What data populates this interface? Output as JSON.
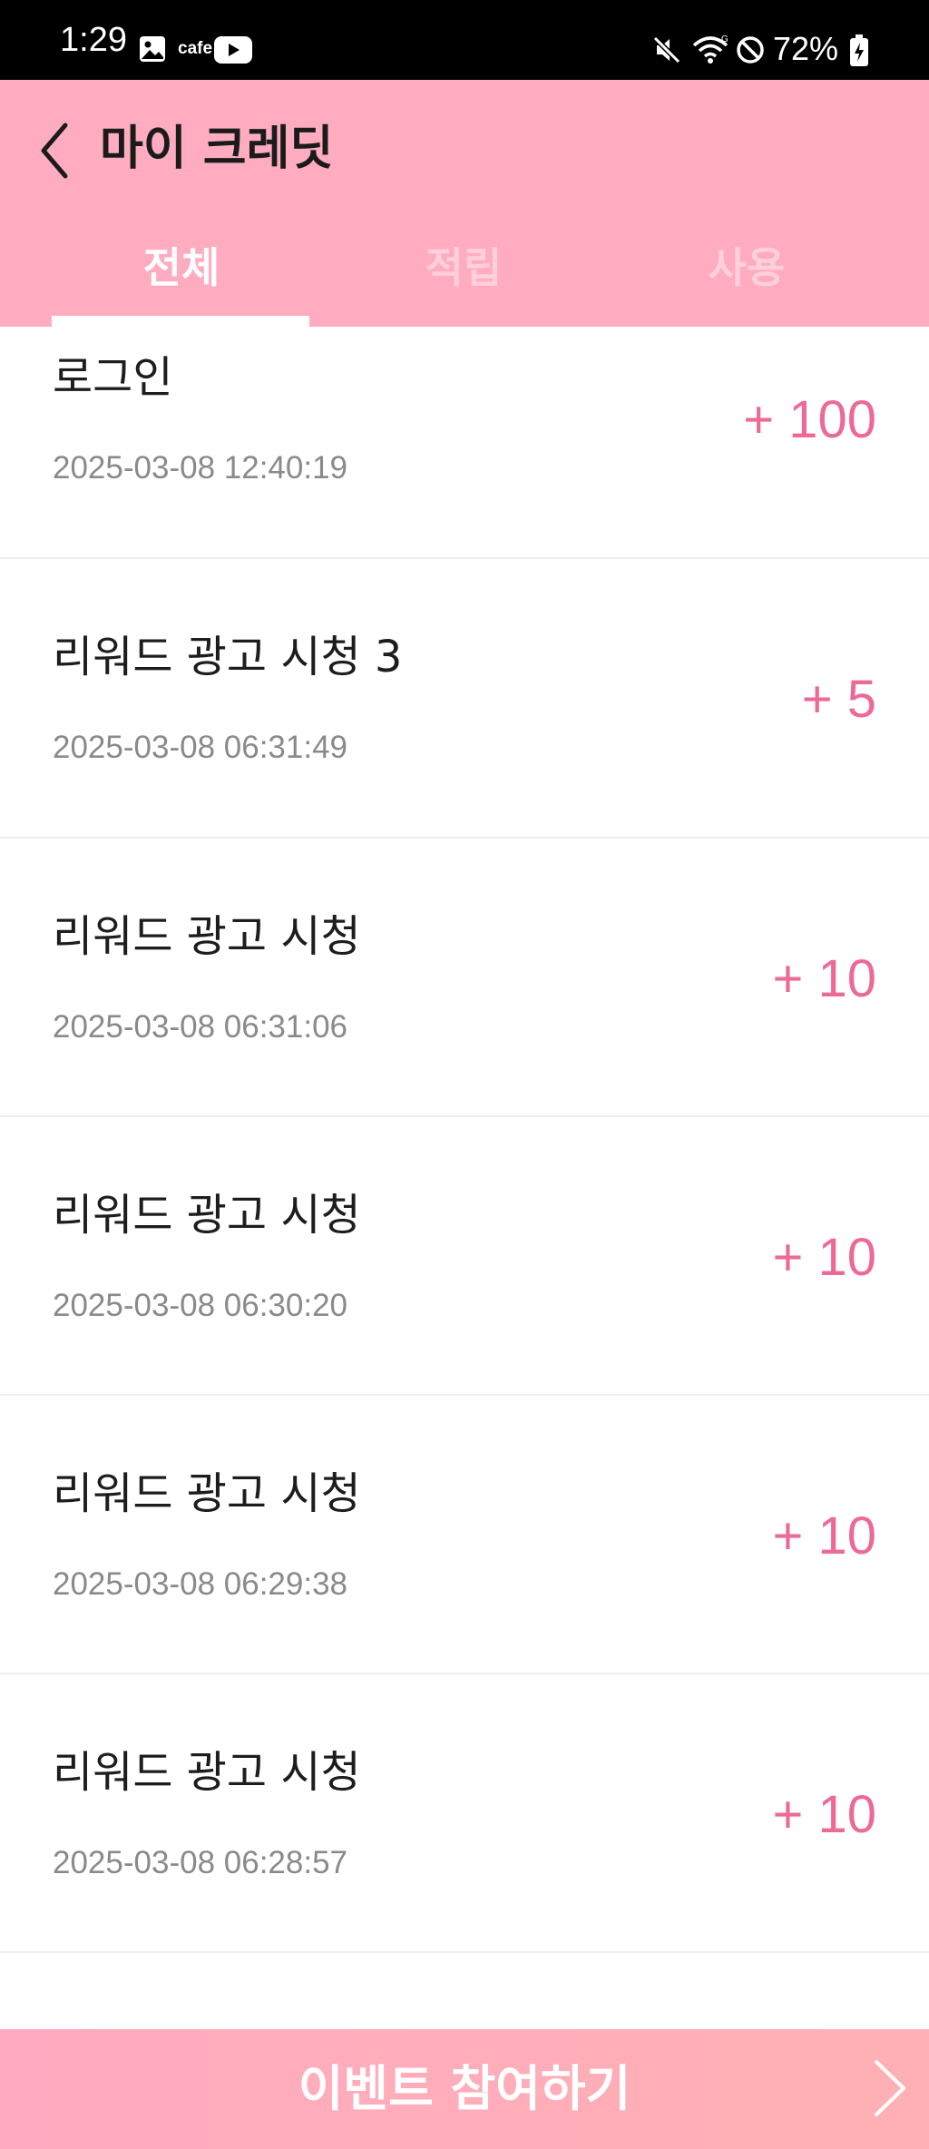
{
  "status_bar": {
    "time": "1:29",
    "cafe_label": "cafe",
    "battery": "72%",
    "icons": [
      "gallery-icon",
      "youtube-icon",
      "mute-icon",
      "wifi-icon",
      "block-icon",
      "battery-icon"
    ]
  },
  "header": {
    "title": "마이 크레딧",
    "back_icon": "chevron-left-icon"
  },
  "tabs": [
    {
      "label": "전체",
      "selected": true
    },
    {
      "label": "적립",
      "selected": false
    },
    {
      "label": "사용",
      "selected": false
    }
  ],
  "items": [
    {
      "title": "로그인",
      "date": "2025-03-08 12:40:19",
      "amount": "+ 100"
    },
    {
      "title": "리워드 광고 시청 3",
      "date": "2025-03-08 06:31:49",
      "amount": "+ 5"
    },
    {
      "title": "리워드 광고 시청",
      "date": "2025-03-08 06:31:06",
      "amount": "+ 10"
    },
    {
      "title": "리워드 광고 시청",
      "date": "2025-03-08 06:30:20",
      "amount": "+ 10"
    },
    {
      "title": "리워드 광고 시청",
      "date": "2025-03-08 06:29:38",
      "amount": "+ 10"
    },
    {
      "title": "리워드 광고 시청",
      "date": "2025-03-08 06:28:57",
      "amount": "+ 10"
    }
  ],
  "event_bar": {
    "label": "이벤트 참여하기",
    "icon": "chevron-right-icon"
  },
  "colors": {
    "header_bg": "#ffacc1",
    "amount": "#ec6a94",
    "tab_selected": "#ffffff",
    "tab_unselected": "#ffd0dc"
  }
}
